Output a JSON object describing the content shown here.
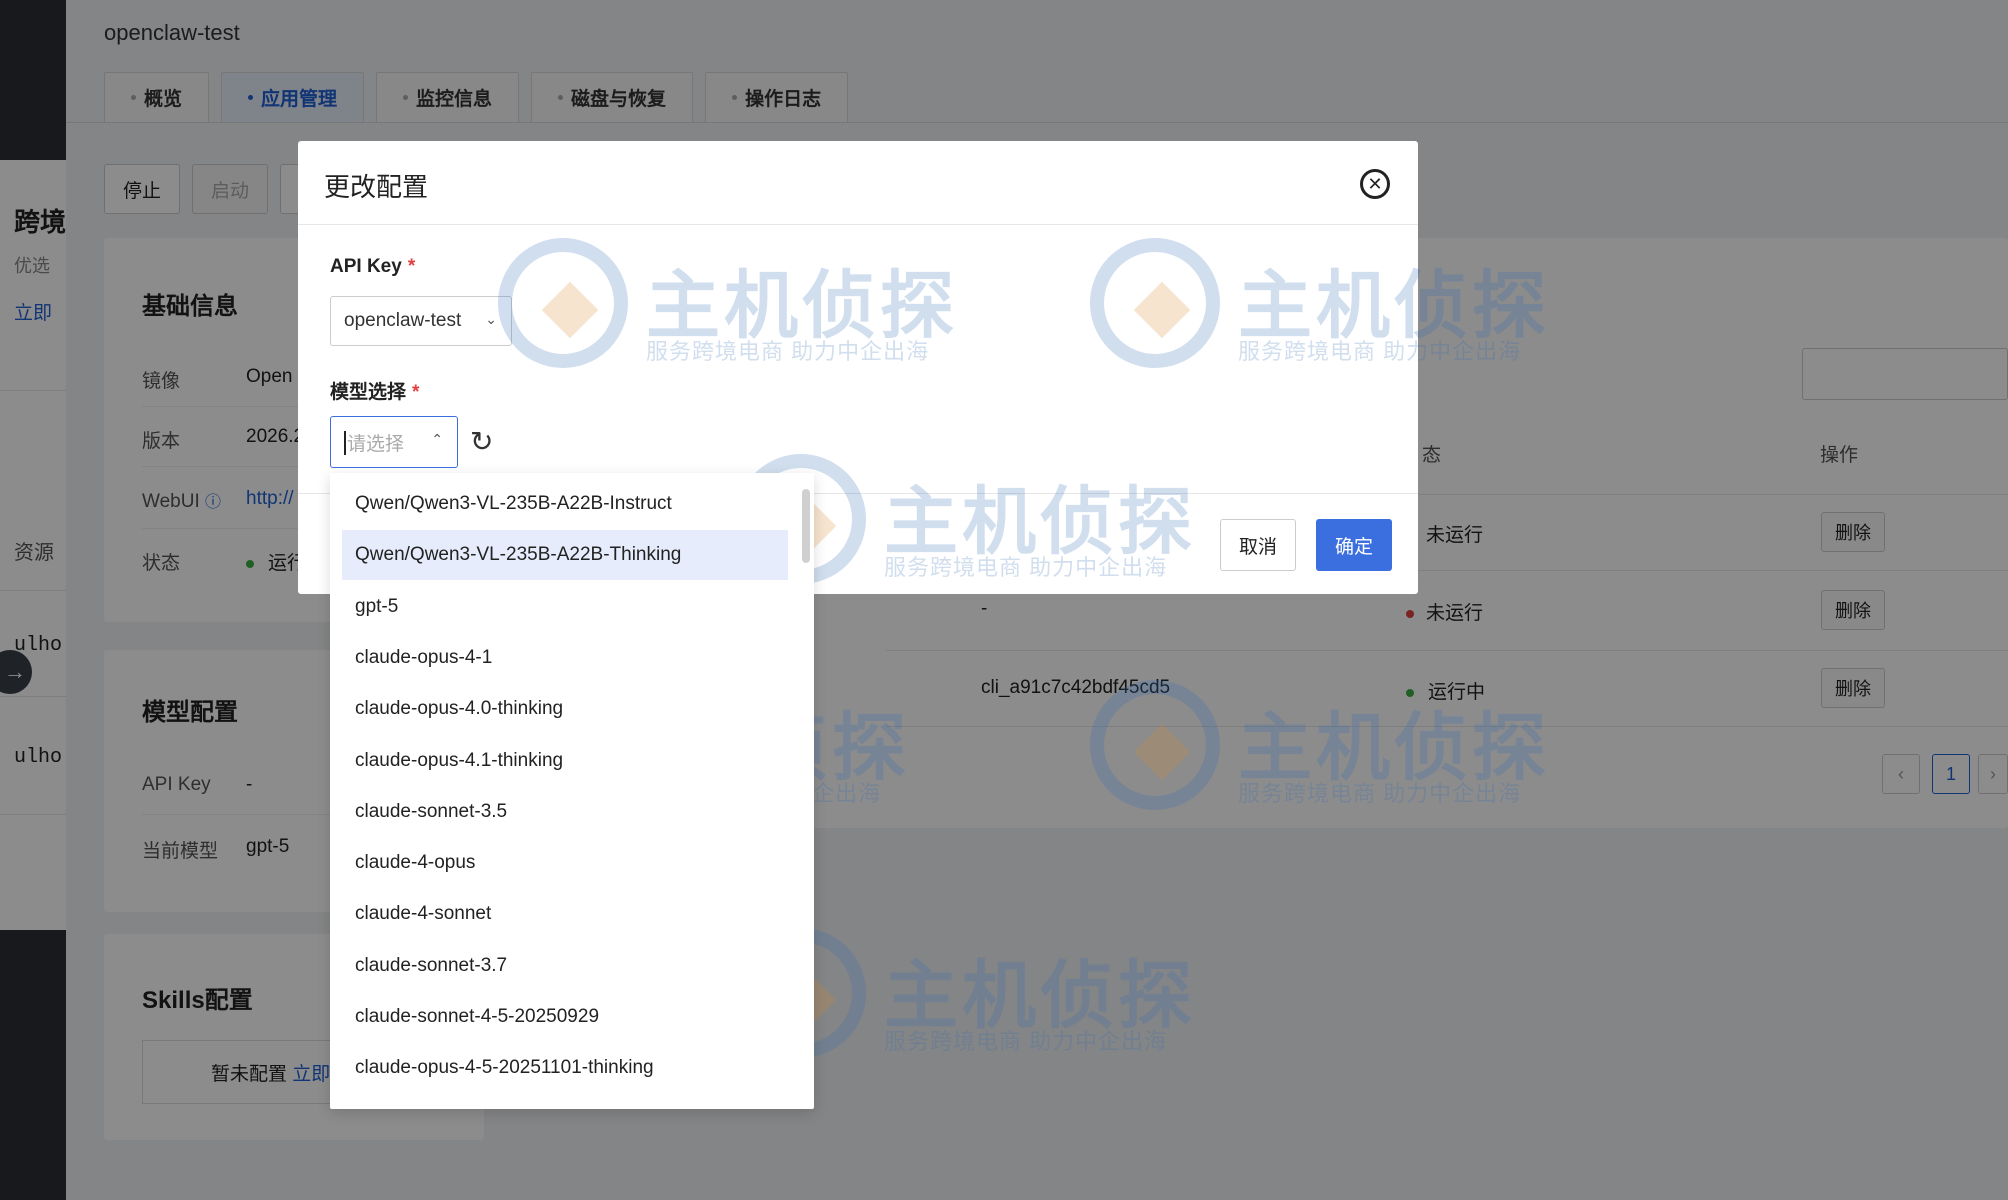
{
  "page": {
    "title": "openclaw-test",
    "tabs": [
      "概览",
      "应用管理",
      "监控信息",
      "磁盘与恢复",
      "操作日志"
    ],
    "active_tab": "应用管理",
    "buttons": {
      "stop": "停止",
      "start": "启动"
    }
  },
  "left_panel": {
    "heading": "跨境",
    "sub": "优选",
    "link": "立即",
    "resource": "资源",
    "row1": "ulho",
    "row2": "ulho"
  },
  "basic_info": {
    "title": "基础信息",
    "rows": [
      {
        "label": "镜像",
        "value": "Open"
      },
      {
        "label": "版本",
        "value": "2026.2"
      },
      {
        "label": "WebUI",
        "value": "http://"
      },
      {
        "label": "状态",
        "value": "运行"
      }
    ]
  },
  "model_config": {
    "title": "模型配置",
    "rows": [
      {
        "label": "API Key",
        "value": "-"
      },
      {
        "label": "当前模型",
        "value": "gpt-5"
      }
    ]
  },
  "skills_config": {
    "title": "Skills配置",
    "empty_text": "暂未配置",
    "link": "立即"
  },
  "table": {
    "headers": {
      "status": "态",
      "action": "操作"
    },
    "rows": [
      {
        "key": "",
        "status": "未运行",
        "status_color": "#e04040",
        "action": "删除"
      },
      {
        "key": "-",
        "status": "未运行",
        "status_color": "#e04040",
        "action": "删除"
      },
      {
        "key": "cli_a91c7c42bdf45cd5",
        "status": "运行中",
        "status_color": "#3cb043",
        "action": "删除"
      }
    ],
    "pagination": {
      "current": "1"
    }
  },
  "watermark": {
    "brand": "主机侦探",
    "slogan": "服务跨境电商 助力中企出海"
  },
  "modal": {
    "title": "更改配置",
    "api_key_label": "API Key",
    "api_key_value": "openclaw-test",
    "model_label": "模型选择",
    "model_placeholder": "请选择",
    "required_mark": "*",
    "cancel": "取消",
    "confirm": "确定"
  },
  "dropdown": {
    "highlighted_index": 1,
    "options": [
      "Qwen/Qwen3-VL-235B-A22B-Instruct",
      "Qwen/Qwen3-VL-235B-A22B-Thinking",
      "gpt-5",
      "claude-opus-4-1",
      "claude-opus-4.0-thinking",
      "claude-opus-4.1-thinking",
      "claude-sonnet-3.5",
      "claude-4-opus",
      "claude-4-sonnet",
      "claude-sonnet-3.7",
      "claude-sonnet-4-5-20250929",
      "claude-opus-4-5-20251101-thinking"
    ]
  },
  "colors": {
    "accent": "#3b6fe0",
    "overlay": "rgba(0,0,0,0.45)",
    "highlight_bg": "#e6ecfb"
  },
  "icons": {
    "close": "close-circle-icon",
    "refresh": "refresh-icon",
    "chevron": "chevron-down-icon",
    "arrow": "arrow-right-icon"
  }
}
